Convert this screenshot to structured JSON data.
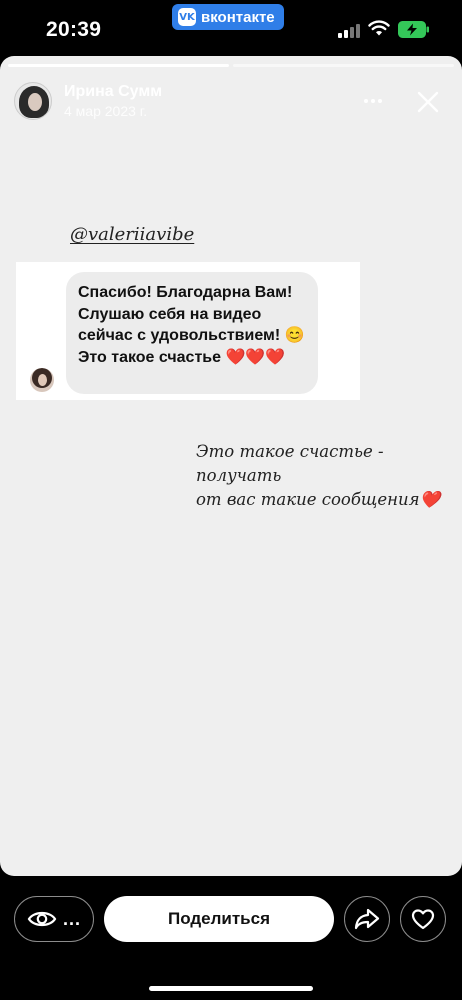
{
  "status_bar": {
    "time": "20:39",
    "app_label": "вконтакте",
    "app_logo": "VK"
  },
  "story": {
    "progress": [
      1.0,
      0.0
    ],
    "author": {
      "name": "Ирина Сумм",
      "date": "4 мар 2023 г."
    },
    "mention": "@valeriiavibe",
    "message": {
      "text": "Спасибо! Благодарна Вам! Слушаю себя на видео сейчас с удовольствием! 😊 Это такое счастье ❤️❤️❤️"
    },
    "caption": {
      "line1": "Это такое счастье -",
      "line2": "получать",
      "line3": "от вас такие сообщения❤️"
    }
  },
  "bottom_bar": {
    "views_more": "...",
    "share_label": "Поделиться"
  },
  "icons": {
    "views": "eye-icon",
    "forward": "forward-arrow-icon",
    "like": "heart-icon",
    "close": "close-icon",
    "more": "more-dots-icon"
  },
  "colors": {
    "vk_blue": "#2f7ee8",
    "battery_green": "#34c759",
    "story_background": "#efefef"
  }
}
